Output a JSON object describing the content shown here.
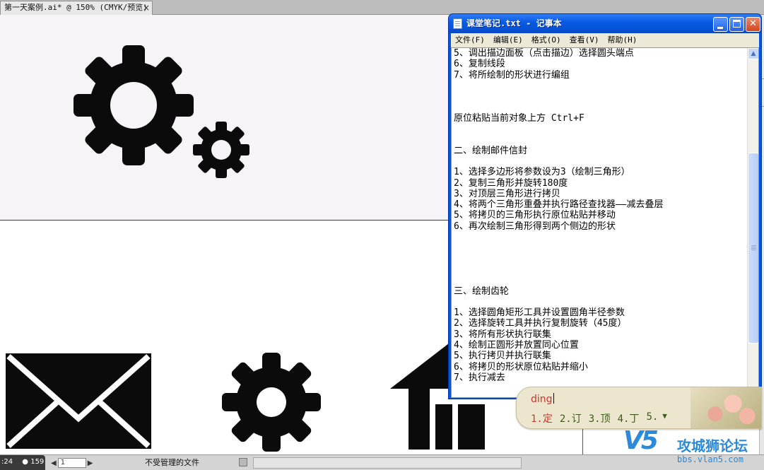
{
  "app": {
    "doc_tab": "第一天案例.ai* @ 150% (CMYK/预览)",
    "doc_tab_close": "×"
  },
  "statusbar": {
    "time": ":24",
    "users": "159",
    "page": "1",
    "file_status": "不受管理的文件"
  },
  "notepad": {
    "title": "课堂笔记.txt - 记事本",
    "menus": [
      "文件(F)",
      "编辑(E)",
      "格式(O)",
      "查看(V)",
      "帮助(H)"
    ],
    "lines": [
      "5、调出描边面板（点击描边）选择圆头端点",
      "6、复制线段",
      "7、将所绘制的形状进行编组",
      "",
      "",
      "",
      "原位粘贴当前对象上方 Ctrl+F",
      "",
      "",
      "二、绘制邮件信封",
      "",
      "1、选择多边形将参数设为3（绘制三角形）",
      "2、复制三角形并旋转180度",
      "3、对顶层三角形进行拷贝",
      "4、将两个三角形重叠并执行路径查找器——减去叠层",
      "5、将拷贝的三角形执行原位粘贴并移动",
      "6、再次绘制三角形得到两个侧边的形状",
      "",
      "",
      "",
      "",
      "",
      "三、绘制齿轮",
      "",
      "1、选择圆角矩形工具并设置圆角半径参数",
      "2、选择旋转工具并执行复制旋转（45度）",
      "3、将所有形状执行联集",
      "4、绘制正圆形并放置同心位置",
      "5、执行拷贝并执行联集",
      "6、将拷贝的形状原位粘贴并缩小",
      "7、执行减去"
    ]
  },
  "ime": {
    "input": "ding",
    "candidates": [
      "1.定",
      "2.订",
      "3.顶",
      "4.丁",
      "5."
    ]
  },
  "watermark": {
    "logo": "V5",
    "name": "攻城狮论坛",
    "url": "bbs.vlan5.com"
  }
}
